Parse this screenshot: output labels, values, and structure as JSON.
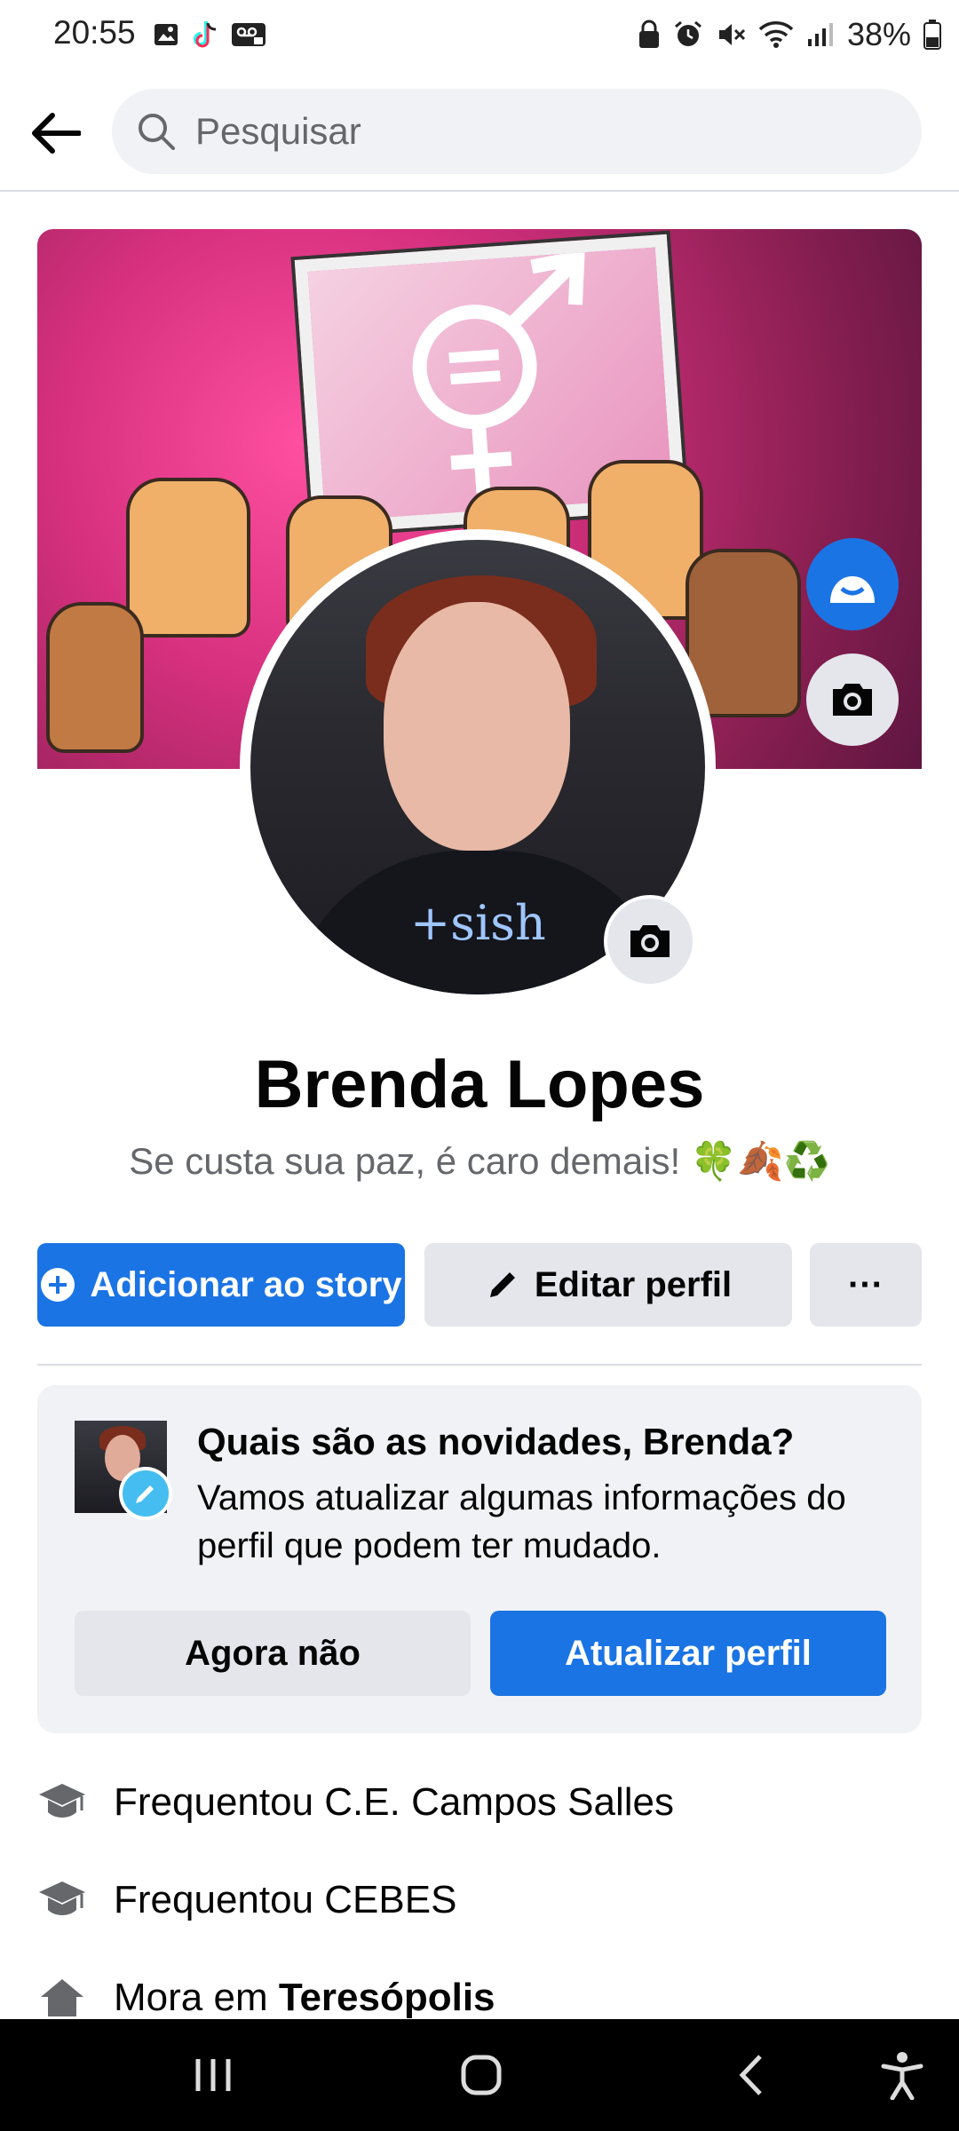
{
  "status_bar": {
    "time": "20:55",
    "battery": "38%",
    "left_icons": [
      "gallery-icon",
      "tiktok-icon",
      "voicemail-icon"
    ],
    "right_icons": [
      "lock-icon",
      "alarm-icon",
      "mute-icon",
      "wifi-icon",
      "signal-icon",
      "battery-icon"
    ]
  },
  "search": {
    "placeholder": "Pesquisar"
  },
  "profile": {
    "name": "Brenda Lopes",
    "bio": "Se custa sua paz, é caro demais! 🍀🍂♻️",
    "shirt_text": "+sish"
  },
  "actions": {
    "add_story": "Adicionar ao story",
    "edit_profile": "Editar perfil",
    "more": "···"
  },
  "update_card": {
    "title": "Quais são as novidades, Brenda?",
    "text": "Vamos atualizar algumas informações do perfil que podem ter mudado.",
    "not_now": "Agora não",
    "update": "Atualizar perfil"
  },
  "details": [
    {
      "icon": "graduation-cap-icon",
      "text": "Frequentou C.E. Campos Salles"
    },
    {
      "icon": "graduation-cap-icon",
      "text": "Frequentou CEBES"
    },
    {
      "icon": "home-icon",
      "prefix": "Mora em ",
      "place": "Teresópolis"
    }
  ],
  "colors": {
    "primary": "#1b74e4",
    "secondary_bg": "#e4e6eb",
    "card_bg": "#f0f2f5",
    "text": "#050505",
    "muted": "#65676b"
  }
}
